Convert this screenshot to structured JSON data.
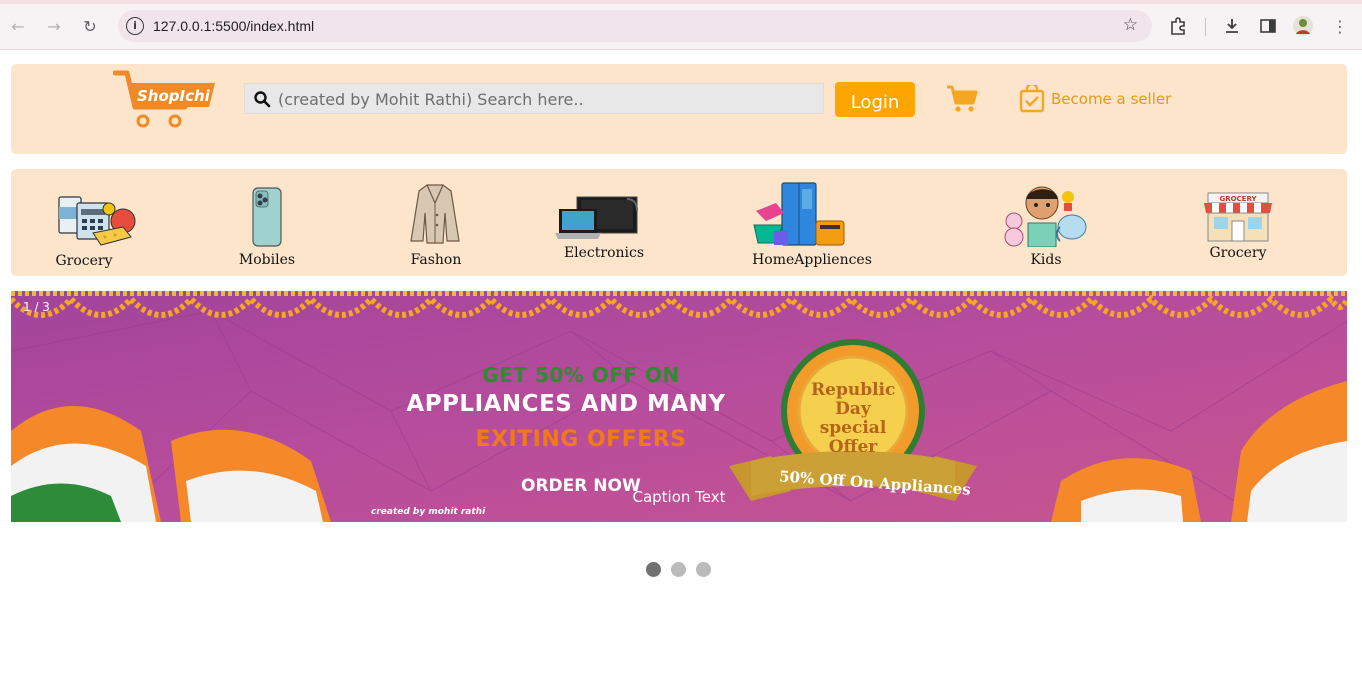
{
  "browser": {
    "url": "127.0.0.1:5500/index.html"
  },
  "header": {
    "logo_text": "ShopIchi",
    "search_placeholder": "(created by Mohit Rathi) Search here..",
    "login_label": "Login",
    "seller_label": "Become a seller"
  },
  "categories": [
    {
      "label": "Grocery",
      "icon": "grocery-items-icon"
    },
    {
      "label": "Mobiles",
      "icon": "mobile-phone-icon"
    },
    {
      "label": "Fashon",
      "icon": "coat-icon"
    },
    {
      "label": "Electronics",
      "icon": "laptop-monitor-icon"
    },
    {
      "label": "HomeAppliences",
      "icon": "home-appliances-icon"
    },
    {
      "label": "Kids",
      "icon": "kids-toys-icon"
    },
    {
      "label": "Grocery",
      "icon": "grocery-store-icon"
    }
  ],
  "slider": {
    "number_text": "1 / 3",
    "caption": "Caption Text",
    "banner": {
      "line1": "GET 50% OFF ON",
      "line2": "APPLIANCES AND MANY",
      "line3": "EXITING OFFERS",
      "cta": "ORDER NOW",
      "credit": "created by mohit rathi",
      "badge_title": "Republic Day special Offer",
      "badge_ribbon": "50% Off On Appliances"
    },
    "dots": 3,
    "active_dot": 1
  },
  "colors": {
    "header_bg": "#fce5cb",
    "accent": "#ffa500",
    "banner_bg": "#b54f9d"
  }
}
